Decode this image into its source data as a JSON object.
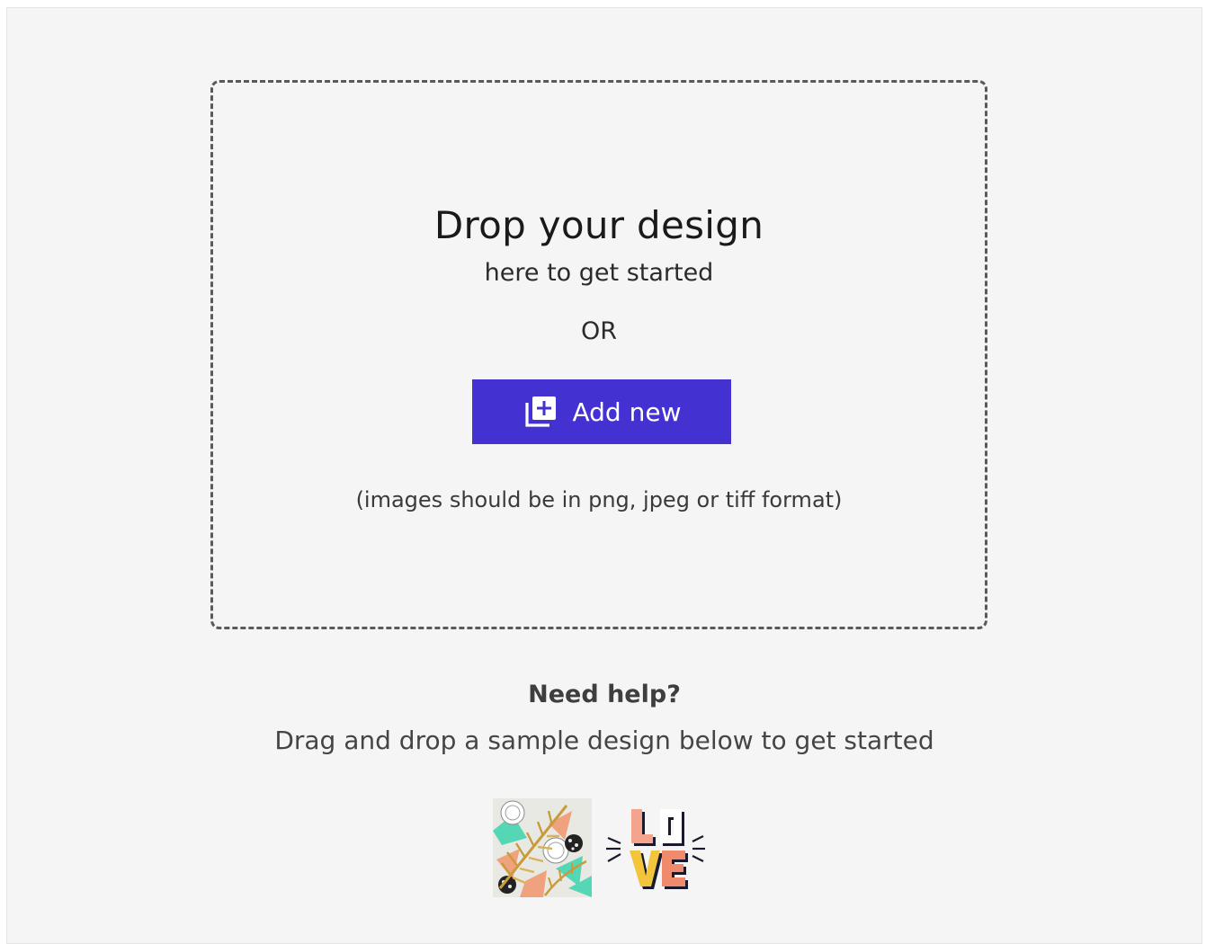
{
  "dropzone": {
    "title": "Drop your design",
    "subtitle": "here to get started",
    "or_label": "OR",
    "add_button_label": "Add new",
    "format_note": "(images should be in png, jpeg or tiff format)"
  },
  "help": {
    "title": "Need help?",
    "text": "Drag and drop a sample design below to get started"
  },
  "samples": [
    {
      "icon": "tropical-pattern-thumbnail"
    },
    {
      "icon": "love-lettering-thumbnail"
    }
  ],
  "colors": {
    "accent": "#4331d1",
    "background": "#f5f5f5",
    "dash_border": "#5a5a5a"
  }
}
